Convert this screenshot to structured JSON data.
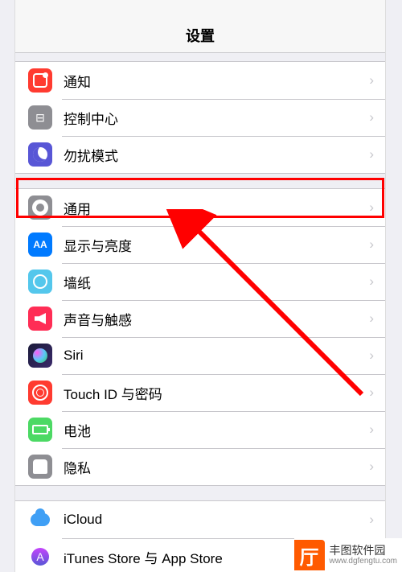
{
  "nav": {
    "title": "设置"
  },
  "groups": [
    {
      "rows": [
        {
          "id": "notifications",
          "label": "通知",
          "icon": "notif"
        },
        {
          "id": "control-center",
          "label": "控制中心",
          "icon": "control"
        },
        {
          "id": "do-not-disturb",
          "label": "勿扰模式",
          "icon": "dnd"
        }
      ]
    },
    {
      "rows": [
        {
          "id": "general",
          "label": "通用",
          "icon": "general",
          "highlighted": true
        },
        {
          "id": "display",
          "label": "显示与亮度",
          "icon": "display"
        },
        {
          "id": "wallpaper",
          "label": "墙纸",
          "icon": "wallpaper"
        },
        {
          "id": "sounds",
          "label": "声音与触感",
          "icon": "sound"
        },
        {
          "id": "siri",
          "label": "Siri",
          "icon": "siri"
        },
        {
          "id": "touchid",
          "label": "Touch ID 与密码",
          "icon": "touchid"
        },
        {
          "id": "battery",
          "label": "电池",
          "icon": "battery"
        },
        {
          "id": "privacy",
          "label": "隐私",
          "icon": "privacy"
        }
      ]
    },
    {
      "rows": [
        {
          "id": "icloud",
          "label": "iCloud",
          "icon": "icloud"
        },
        {
          "id": "itunes",
          "label": "iTunes Store 与 App Store",
          "icon": "itunes"
        }
      ]
    }
  ],
  "watermark": {
    "brand": "丰图软件园",
    "url": "www.dgfengtu.com"
  },
  "annotation": {
    "highlight_color": "#ff0000",
    "target_row": "general"
  }
}
